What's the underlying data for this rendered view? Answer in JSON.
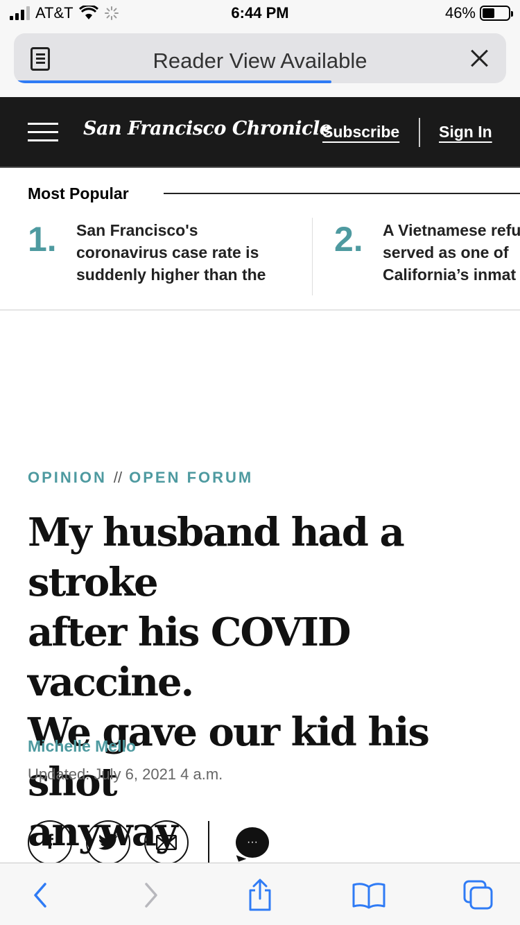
{
  "status_bar": {
    "carrier": "AT&T",
    "time": "6:44 PM",
    "battery_percent": "46%",
    "battery_level": 0.46
  },
  "browser": {
    "reader_banner": "Reader View Available",
    "load_progress": 0.64,
    "accent_color": "#2f7bf5"
  },
  "site_header": {
    "logo": "San Francisco Chronicle",
    "subscribe": "Subscribe",
    "sign_in": "Sign In"
  },
  "most_popular": {
    "title": "Most Popular",
    "items": [
      {
        "number": "1.",
        "lines": [
          "San Francisco's",
          "coronavirus case rate is",
          "suddenly higher than the"
        ]
      },
      {
        "number": "2.",
        "lines": [
          "A Vietnamese refu",
          "served as one of",
          "California’s inmat"
        ]
      }
    ]
  },
  "article": {
    "section": "OPINION",
    "separator": "//",
    "subsection": "OPEN FORUM",
    "headline_lines": [
      "My husband had a stroke",
      "after his COVID vaccine.",
      "We gave our kid his shot",
      "anyway"
    ],
    "author": "Michelle Mello",
    "updated": "Updated: July 6, 2021 4 a.m.",
    "accent_color": "#4e9aa0"
  },
  "share": {
    "facebook_glyph": "f",
    "comment_glyph": "···"
  },
  "toolbar": {
    "icons": [
      "back-icon",
      "forward-icon",
      "share-icon",
      "bookmarks-icon",
      "tabs-icon"
    ]
  }
}
